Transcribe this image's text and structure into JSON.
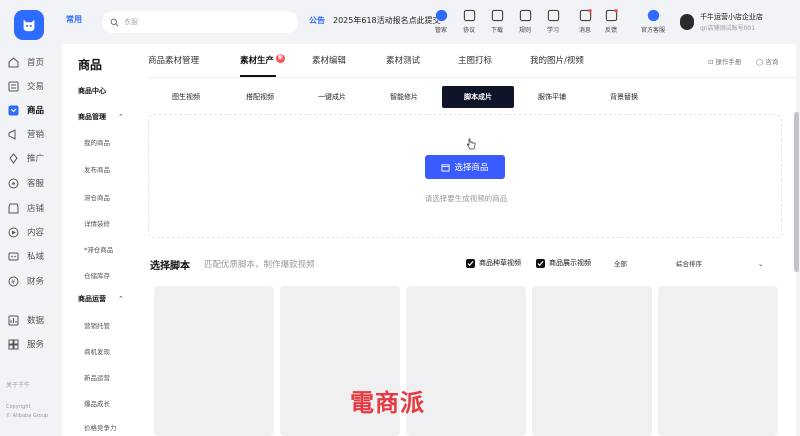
{
  "rail": {
    "items": [
      {
        "label": "首页",
        "icon": "home-icon"
      },
      {
        "label": "交易",
        "icon": "trade-icon"
      },
      {
        "label": "商品",
        "icon": "goods-icon",
        "active": true
      },
      {
        "label": "营销",
        "icon": "marketing-icon"
      },
      {
        "label": "推广",
        "icon": "promotion-icon"
      },
      {
        "label": "客服",
        "icon": "service-icon"
      },
      {
        "label": "店铺",
        "icon": "shop-icon"
      },
      {
        "label": "内容",
        "icon": "content-icon"
      },
      {
        "label": "私域",
        "icon": "private-icon"
      },
      {
        "label": "财务",
        "icon": "finance-icon"
      },
      {
        "label": "数据",
        "icon": "data-icon"
      },
      {
        "label": "服务",
        "icon": "apps-icon"
      }
    ],
    "about": "关于千牛",
    "copyright": "Copyright",
    "company": "© Alibaba Group"
  },
  "top": {
    "changyong": "常用",
    "search_placeholder": "衣服",
    "notice_tag": "公告",
    "notice_text": "2025年618活动报名点此提交",
    "tools": [
      {
        "label": "管家",
        "icon": "butler-icon"
      },
      {
        "label": "协议",
        "icon": "agreement-icon"
      },
      {
        "label": "下载",
        "icon": "download-icon"
      },
      {
        "label": "规则",
        "icon": "rules-icon"
      },
      {
        "label": "学习",
        "icon": "learn-icon"
      },
      {
        "label": "消息",
        "icon": "message-icon"
      },
      {
        "label": "反馈",
        "icon": "feedback-icon"
      },
      {
        "label": "官方客服",
        "icon": "official-service-icon"
      }
    ],
    "user_name": "千牛运营小店企业店",
    "user_sub": "qn店铺测试账号001"
  },
  "subnav": {
    "title": "商品",
    "center": "商品中心",
    "manage": "商品管理",
    "manage_items": [
      "我的商品",
      "发布商品",
      "滞仓商品",
      "详情装修",
      "*滞仓商品",
      "仓储库存"
    ],
    "ops": "商品运营",
    "ops_items": [
      "营销托管",
      "商机发现",
      "新品运营",
      "爆品成长",
      "价格竞争力"
    ]
  },
  "main": {
    "tabs": [
      "商品素材管理",
      "素材生产",
      "素材编辑",
      "素材测试",
      "主图打标",
      "我的图片/视频"
    ],
    "active_tab": 1,
    "badge": "新",
    "manual": "操作手册",
    "consult": "咨询",
    "sub_tabs": [
      "图生视频",
      "搭配视频",
      "一键成片",
      "智能修片",
      "脚本成片",
      "服饰平铺",
      "背景替换"
    ],
    "active_sub_tab": 4,
    "pick_button": "选择商品",
    "hint": "请选择要生成视频的商品",
    "section_title": "选择脚本",
    "section_sub": "匹配优质脚本，制作爆款视频",
    "check1": "商品种草视频",
    "check2": "商品展示视频",
    "filter": "全部",
    "sort": "综合排序"
  },
  "watermark": "電商派",
  "colors": {
    "accent": "#2e6bff",
    "button": "#3a5bff",
    "active_tab": "#101428",
    "watermark": "#e53a40"
  }
}
